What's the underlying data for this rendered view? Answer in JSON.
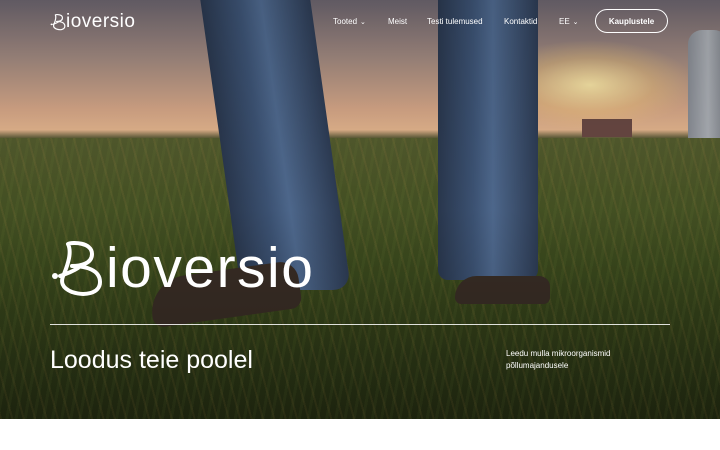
{
  "brand": {
    "name": "ioversio"
  },
  "nav": {
    "items": [
      {
        "label": "Tooted",
        "has_dropdown": true
      },
      {
        "label": "Meist",
        "has_dropdown": false
      },
      {
        "label": "Testi tulemused",
        "has_dropdown": false
      },
      {
        "label": "Kontaktid",
        "has_dropdown": false
      }
    ],
    "language": {
      "label": "EE",
      "has_dropdown": true
    },
    "shop_button": "Kauplustele"
  },
  "hero": {
    "tagline": "Loodus teie poolel",
    "subtext": "Leedu mulla mikroorganismid põllumajandusele"
  },
  "colors": {
    "text": "#ffffff",
    "page_background": "#ffffff"
  },
  "icons": {
    "logo_mark": "stylized-B-logo-icon",
    "dropdown": "chevron-down-icon"
  }
}
